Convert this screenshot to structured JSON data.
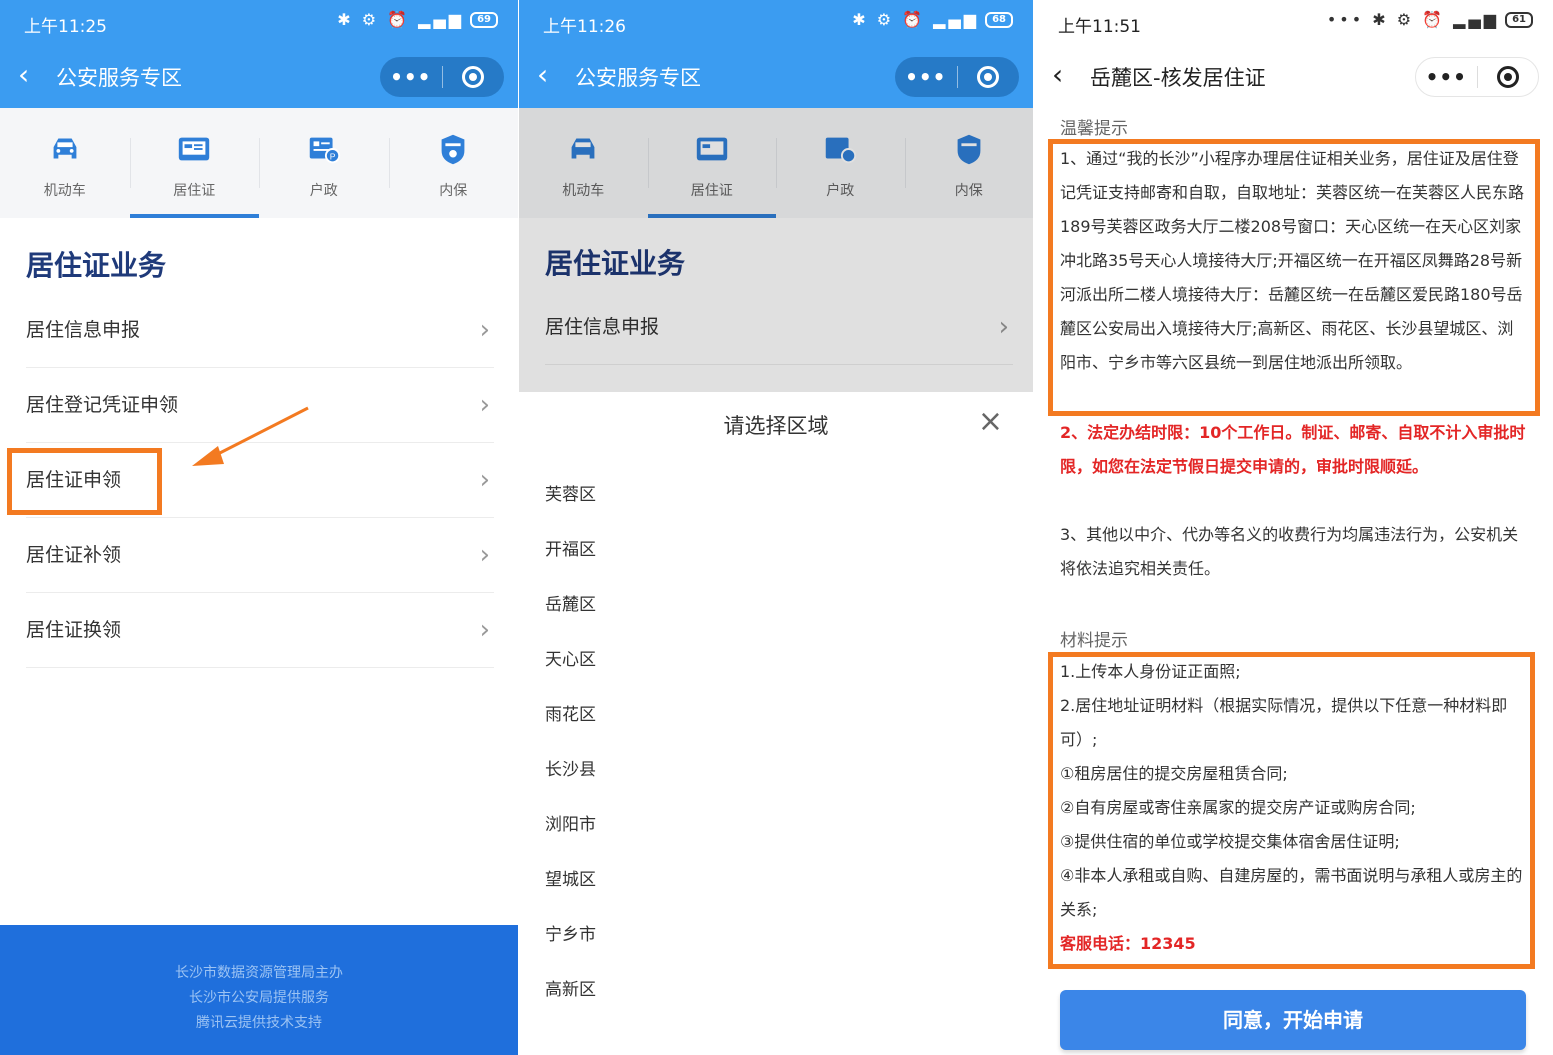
{
  "panel1": {
    "status_time": "上午11:25",
    "battery": "69",
    "nav_title": "公安服务专区",
    "tabs": [
      "机动车",
      "居住证",
      "户政",
      "内保"
    ],
    "section_title": "居住证业务",
    "menu": [
      "居住信息申报",
      "居住登记凭证申领",
      "居住证申领",
      "居住证补领",
      "居住证换领"
    ],
    "footer": [
      "长沙市数据资源管理局主办",
      "长沙市公安局提供服务",
      "腾讯云提供技术支持"
    ]
  },
  "panel2": {
    "status_time": "上午11:26",
    "battery": "68",
    "nav_title": "公安服务专区",
    "tabs": [
      "机动车",
      "居住证",
      "户政",
      "内保"
    ],
    "section_title": "居住证业务",
    "menu": [
      "居住信息申报"
    ],
    "sheet_title": "请选择区域",
    "regions": [
      "芙蓉区",
      "开福区",
      "岳麓区",
      "天心区",
      "雨花区",
      "长沙县",
      "浏阳市",
      "望城区",
      "宁乡市",
      "高新区"
    ]
  },
  "panel3": {
    "status_time": "上午11:51",
    "battery": "61",
    "nav_title": "岳麓区-核发居住证",
    "tip_title": "温馨提示",
    "tip1": "1、通过“我的长沙”小程序办理居住证相关业务，居住证及居住登记凭证支持邮寄和自取，自取地址：芙蓉区统一在芙蓉区人民东路189号芙蓉区政务大厅二楼208号窗口：天心区统一在天心区刘家冲北路35号天心人境接待大厅;开福区统一在开福区凤舞路28号新河派出所二楼人境接待大厅：岳麓区统一在岳麓区爱民路180号岳麓区公安局出入境接待大厅;高新区、雨花区、长沙县望城区、浏阳市、宁乡市等六区县统一到居住地派出所领取。",
    "tip2": "2、法定办结时限：10个工作日。制证、邮寄、自取不计入审批时限，如您在法定节假日提交申请的，审批时限顺延。",
    "tip3": "3、其他以中介、代办等名义的收费行为均属违法行为，公安机关将依法追究相关责任。",
    "material_title": "材料提示",
    "materials": [
      "1.上传本人身份证正面照;",
      "2.居住地址证明材料（根据实际情况，提供以下任意一种材料即可）;",
      "①租房居住的提交房屋租赁合同;",
      "②自有房屋或寄住亲属家的提交房产证或购房合同;",
      "③提供住宿的单位或学校提交集体宿舍居住证明;",
      "④非本人承租或自购、自建房屋的，需书面说明与承租人或房主的关系;"
    ],
    "hotline": "客服电话：12345",
    "agree_button": "同意，开始申请"
  },
  "colors": {
    "brand_blue": "#3b9cf1",
    "highlight_orange": "#f37a21",
    "warning_red": "#e32626",
    "footer_blue": "#1f6fdc"
  }
}
